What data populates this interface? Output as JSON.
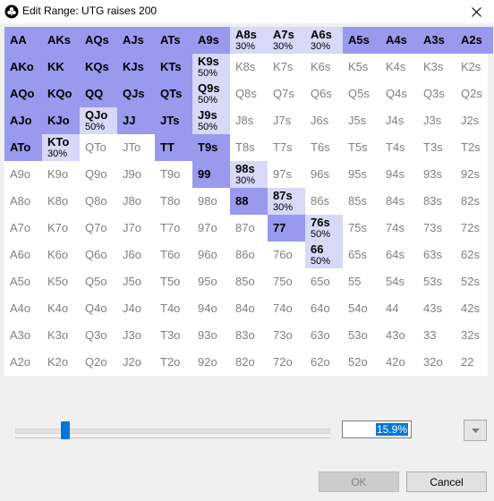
{
  "window": {
    "title": "Edit Range: UTG raises 200",
    "close_label": "✕"
  },
  "grid": {
    "rows": [
      [
        {
          "hand": "AA",
          "state": "full"
        },
        {
          "hand": "AKs",
          "state": "full"
        },
        {
          "hand": "AQs",
          "state": "full"
        },
        {
          "hand": "AJs",
          "state": "full"
        },
        {
          "hand": "ATs",
          "state": "full"
        },
        {
          "hand": "A9s",
          "state": "full"
        },
        {
          "hand": "A8s",
          "state": "partial",
          "freq": "30%"
        },
        {
          "hand": "A7s",
          "state": "partial",
          "freq": "30%"
        },
        {
          "hand": "A6s",
          "state": "partial",
          "freq": "30%"
        },
        {
          "hand": "A5s",
          "state": "full"
        },
        {
          "hand": "A4s",
          "state": "full"
        },
        {
          "hand": "A3s",
          "state": "full"
        },
        {
          "hand": "A2s",
          "state": "full"
        }
      ],
      [
        {
          "hand": "AKo",
          "state": "full"
        },
        {
          "hand": "KK",
          "state": "full"
        },
        {
          "hand": "KQs",
          "state": "full"
        },
        {
          "hand": "KJs",
          "state": "full"
        },
        {
          "hand": "KTs",
          "state": "full"
        },
        {
          "hand": "K9s",
          "state": "partial",
          "freq": "50%"
        },
        {
          "hand": "K8s",
          "state": "none"
        },
        {
          "hand": "K7s",
          "state": "none"
        },
        {
          "hand": "K6s",
          "state": "none"
        },
        {
          "hand": "K5s",
          "state": "none"
        },
        {
          "hand": "K4s",
          "state": "none"
        },
        {
          "hand": "K3s",
          "state": "none"
        },
        {
          "hand": "K2s",
          "state": "none"
        }
      ],
      [
        {
          "hand": "AQo",
          "state": "full"
        },
        {
          "hand": "KQo",
          "state": "full"
        },
        {
          "hand": "QQ",
          "state": "full"
        },
        {
          "hand": "QJs",
          "state": "full"
        },
        {
          "hand": "QTs",
          "state": "full"
        },
        {
          "hand": "Q9s",
          "state": "partial",
          "freq": "50%"
        },
        {
          "hand": "Q8s",
          "state": "none"
        },
        {
          "hand": "Q7s",
          "state": "none"
        },
        {
          "hand": "Q6s",
          "state": "none"
        },
        {
          "hand": "Q5s",
          "state": "none"
        },
        {
          "hand": "Q4s",
          "state": "none"
        },
        {
          "hand": "Q3s",
          "state": "none"
        },
        {
          "hand": "Q2s",
          "state": "none"
        }
      ],
      [
        {
          "hand": "AJo",
          "state": "full"
        },
        {
          "hand": "KJo",
          "state": "full"
        },
        {
          "hand": "QJo",
          "state": "partial",
          "freq": "50%"
        },
        {
          "hand": "JJ",
          "state": "full"
        },
        {
          "hand": "JTs",
          "state": "full"
        },
        {
          "hand": "J9s",
          "state": "partial",
          "freq": "50%"
        },
        {
          "hand": "J8s",
          "state": "none"
        },
        {
          "hand": "J7s",
          "state": "none"
        },
        {
          "hand": "J6s",
          "state": "none"
        },
        {
          "hand": "J5s",
          "state": "none"
        },
        {
          "hand": "J4s",
          "state": "none"
        },
        {
          "hand": "J3s",
          "state": "none"
        },
        {
          "hand": "J2s",
          "state": "none"
        }
      ],
      [
        {
          "hand": "ATo",
          "state": "full"
        },
        {
          "hand": "KTo",
          "state": "partial",
          "freq": "30%"
        },
        {
          "hand": "QTo",
          "state": "none"
        },
        {
          "hand": "JTo",
          "state": "none"
        },
        {
          "hand": "TT",
          "state": "full"
        },
        {
          "hand": "T9s",
          "state": "full"
        },
        {
          "hand": "T8s",
          "state": "none"
        },
        {
          "hand": "T7s",
          "state": "none"
        },
        {
          "hand": "T6s",
          "state": "none"
        },
        {
          "hand": "T5s",
          "state": "none"
        },
        {
          "hand": "T4s",
          "state": "none"
        },
        {
          "hand": "T3s",
          "state": "none"
        },
        {
          "hand": "T2s",
          "state": "none"
        }
      ],
      [
        {
          "hand": "A9o",
          "state": "none"
        },
        {
          "hand": "K9o",
          "state": "none"
        },
        {
          "hand": "Q9o",
          "state": "none"
        },
        {
          "hand": "J9o",
          "state": "none"
        },
        {
          "hand": "T9o",
          "state": "none"
        },
        {
          "hand": "99",
          "state": "full"
        },
        {
          "hand": "98s",
          "state": "partial",
          "freq": "30%"
        },
        {
          "hand": "97s",
          "state": "none"
        },
        {
          "hand": "96s",
          "state": "none"
        },
        {
          "hand": "95s",
          "state": "none"
        },
        {
          "hand": "94s",
          "state": "none"
        },
        {
          "hand": "93s",
          "state": "none"
        },
        {
          "hand": "92s",
          "state": "none"
        }
      ],
      [
        {
          "hand": "A8o",
          "state": "none"
        },
        {
          "hand": "K8o",
          "state": "none"
        },
        {
          "hand": "Q8o",
          "state": "none"
        },
        {
          "hand": "J8o",
          "state": "none"
        },
        {
          "hand": "T8o",
          "state": "none"
        },
        {
          "hand": "98o",
          "state": "none"
        },
        {
          "hand": "88",
          "state": "full"
        },
        {
          "hand": "87s",
          "state": "partial",
          "freq": "30%"
        },
        {
          "hand": "86s",
          "state": "none"
        },
        {
          "hand": "85s",
          "state": "none"
        },
        {
          "hand": "84s",
          "state": "none"
        },
        {
          "hand": "83s",
          "state": "none"
        },
        {
          "hand": "82s",
          "state": "none"
        }
      ],
      [
        {
          "hand": "A7o",
          "state": "none"
        },
        {
          "hand": "K7o",
          "state": "none"
        },
        {
          "hand": "Q7o",
          "state": "none"
        },
        {
          "hand": "J7o",
          "state": "none"
        },
        {
          "hand": "T7o",
          "state": "none"
        },
        {
          "hand": "97o",
          "state": "none"
        },
        {
          "hand": "87o",
          "state": "none"
        },
        {
          "hand": "77",
          "state": "full"
        },
        {
          "hand": "76s",
          "state": "partial",
          "freq": "50%"
        },
        {
          "hand": "75s",
          "state": "none"
        },
        {
          "hand": "74s",
          "state": "none"
        },
        {
          "hand": "73s",
          "state": "none"
        },
        {
          "hand": "72s",
          "state": "none"
        }
      ],
      [
        {
          "hand": "A6o",
          "state": "none"
        },
        {
          "hand": "K6o",
          "state": "none"
        },
        {
          "hand": "Q6o",
          "state": "none"
        },
        {
          "hand": "J6o",
          "state": "none"
        },
        {
          "hand": "T6o",
          "state": "none"
        },
        {
          "hand": "96o",
          "state": "none"
        },
        {
          "hand": "86o",
          "state": "none"
        },
        {
          "hand": "76o",
          "state": "none"
        },
        {
          "hand": "66",
          "state": "partial",
          "freq": "50%"
        },
        {
          "hand": "65s",
          "state": "none"
        },
        {
          "hand": "64s",
          "state": "none"
        },
        {
          "hand": "63s",
          "state": "none"
        },
        {
          "hand": "62s",
          "state": "none"
        }
      ],
      [
        {
          "hand": "A5o",
          "state": "none"
        },
        {
          "hand": "K5o",
          "state": "none"
        },
        {
          "hand": "Q5o",
          "state": "none"
        },
        {
          "hand": "J5o",
          "state": "none"
        },
        {
          "hand": "T5o",
          "state": "none"
        },
        {
          "hand": "95o",
          "state": "none"
        },
        {
          "hand": "85o",
          "state": "none"
        },
        {
          "hand": "75o",
          "state": "none"
        },
        {
          "hand": "65o",
          "state": "none"
        },
        {
          "hand": "55",
          "state": "none"
        },
        {
          "hand": "54s",
          "state": "none"
        },
        {
          "hand": "53s",
          "state": "none"
        },
        {
          "hand": "52s",
          "state": "none"
        }
      ],
      [
        {
          "hand": "A4o",
          "state": "none"
        },
        {
          "hand": "K4o",
          "state": "none"
        },
        {
          "hand": "Q4o",
          "state": "none"
        },
        {
          "hand": "J4o",
          "state": "none"
        },
        {
          "hand": "T4o",
          "state": "none"
        },
        {
          "hand": "94o",
          "state": "none"
        },
        {
          "hand": "84o",
          "state": "none"
        },
        {
          "hand": "74o",
          "state": "none"
        },
        {
          "hand": "64o",
          "state": "none"
        },
        {
          "hand": "54o",
          "state": "none"
        },
        {
          "hand": "44",
          "state": "none"
        },
        {
          "hand": "43s",
          "state": "none"
        },
        {
          "hand": "42s",
          "state": "none"
        }
      ],
      [
        {
          "hand": "A3o",
          "state": "none"
        },
        {
          "hand": "K3o",
          "state": "none"
        },
        {
          "hand": "Q3o",
          "state": "none"
        },
        {
          "hand": "J3o",
          "state": "none"
        },
        {
          "hand": "T3o",
          "state": "none"
        },
        {
          "hand": "93o",
          "state": "none"
        },
        {
          "hand": "83o",
          "state": "none"
        },
        {
          "hand": "73o",
          "state": "none"
        },
        {
          "hand": "63o",
          "state": "none"
        },
        {
          "hand": "53o",
          "state": "none"
        },
        {
          "hand": "43o",
          "state": "none"
        },
        {
          "hand": "33",
          "state": "none"
        },
        {
          "hand": "32s",
          "state": "none"
        }
      ],
      [
        {
          "hand": "A2o",
          "state": "none"
        },
        {
          "hand": "K2o",
          "state": "none"
        },
        {
          "hand": "Q2o",
          "state": "none"
        },
        {
          "hand": "J2o",
          "state": "none"
        },
        {
          "hand": "T2o",
          "state": "none"
        },
        {
          "hand": "92o",
          "state": "none"
        },
        {
          "hand": "82o",
          "state": "none"
        },
        {
          "hand": "72o",
          "state": "none"
        },
        {
          "hand": "62o",
          "state": "none"
        },
        {
          "hand": "52o",
          "state": "none"
        },
        {
          "hand": "42o",
          "state": "none"
        },
        {
          "hand": "32o",
          "state": "none"
        },
        {
          "hand": "22",
          "state": "none"
        }
      ]
    ]
  },
  "slider": {
    "value_fraction": 0.159
  },
  "percent_input": {
    "value": "15.9%"
  },
  "buttons": {
    "ok_label": "OK",
    "cancel_label": "Cancel"
  },
  "colors": {
    "full": "#9999ee",
    "partial": "#d8d8f8",
    "selection": "#0078d7"
  }
}
